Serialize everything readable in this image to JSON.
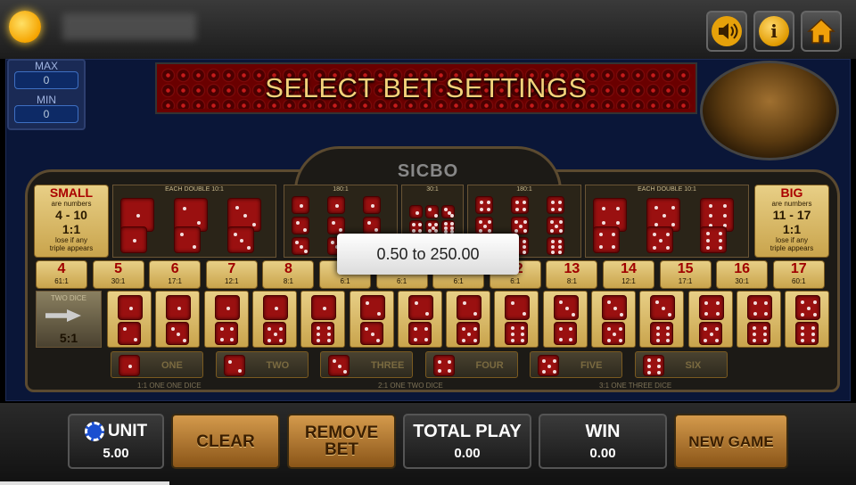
{
  "header": {
    "icons": [
      "sound-icon",
      "info-icon",
      "home-icon"
    ]
  },
  "limits": {
    "max_label": "MAX",
    "max_value": "0",
    "min_label": "MIN",
    "min_value": "0"
  },
  "title": "SELECT BET SETTINGS",
  "table_name": "SICBO",
  "small": {
    "title": "SMALL",
    "line1": "are numbers",
    "range": "4 - 10",
    "odds": "1:1",
    "note1": "lose if any",
    "note2": "triple appears"
  },
  "big": {
    "title": "BIG",
    "line1": "are numbers",
    "range": "11 - 17",
    "odds": "1:1",
    "note1": "lose if any",
    "note2": "triple appears"
  },
  "each_double_label": "EACH DOUBLE 10:1",
  "triple_label": "180:1",
  "any_triple_label": "30:1",
  "numbers": [
    {
      "n": "4",
      "odds": "61:1"
    },
    {
      "n": "5",
      "odds": "30:1"
    },
    {
      "n": "6",
      "odds": "17:1"
    },
    {
      "n": "7",
      "odds": "12:1"
    },
    {
      "n": "8",
      "odds": "8:1"
    },
    {
      "n": "9",
      "odds": "6:1"
    },
    {
      "n": "10",
      "odds": "6:1"
    },
    {
      "n": "11",
      "odds": "6:1"
    },
    {
      "n": "12",
      "odds": "6:1"
    },
    {
      "n": "13",
      "odds": "8:1"
    },
    {
      "n": "14",
      "odds": "12:1"
    },
    {
      "n": "15",
      "odds": "17:1"
    },
    {
      "n": "16",
      "odds": "30:1"
    },
    {
      "n": "17",
      "odds": "60:1"
    }
  ],
  "two_dice": {
    "label": "TWO DICE",
    "odds": "5:1"
  },
  "singles": [
    "ONE",
    "TWO",
    "THREE",
    "FOUR",
    "FIVE",
    "SIX"
  ],
  "footer_labels": [
    "1:1 ONE ONE DICE",
    "2:1 ONE TWO DICE",
    "3:1 ONE THREE DICE"
  ],
  "popup": "0.50 to 250.00",
  "controls": {
    "unit_label": "UNIT",
    "unit_value": "5.00",
    "clear": "CLEAR",
    "remove_bet_1": "REMOVE",
    "remove_bet_2": "BET",
    "total_play_label": "TOTAL PLAY",
    "total_play_value": "0.00",
    "win_label": "WIN",
    "win_value": "0.00",
    "new_game": "NEW GAME"
  }
}
